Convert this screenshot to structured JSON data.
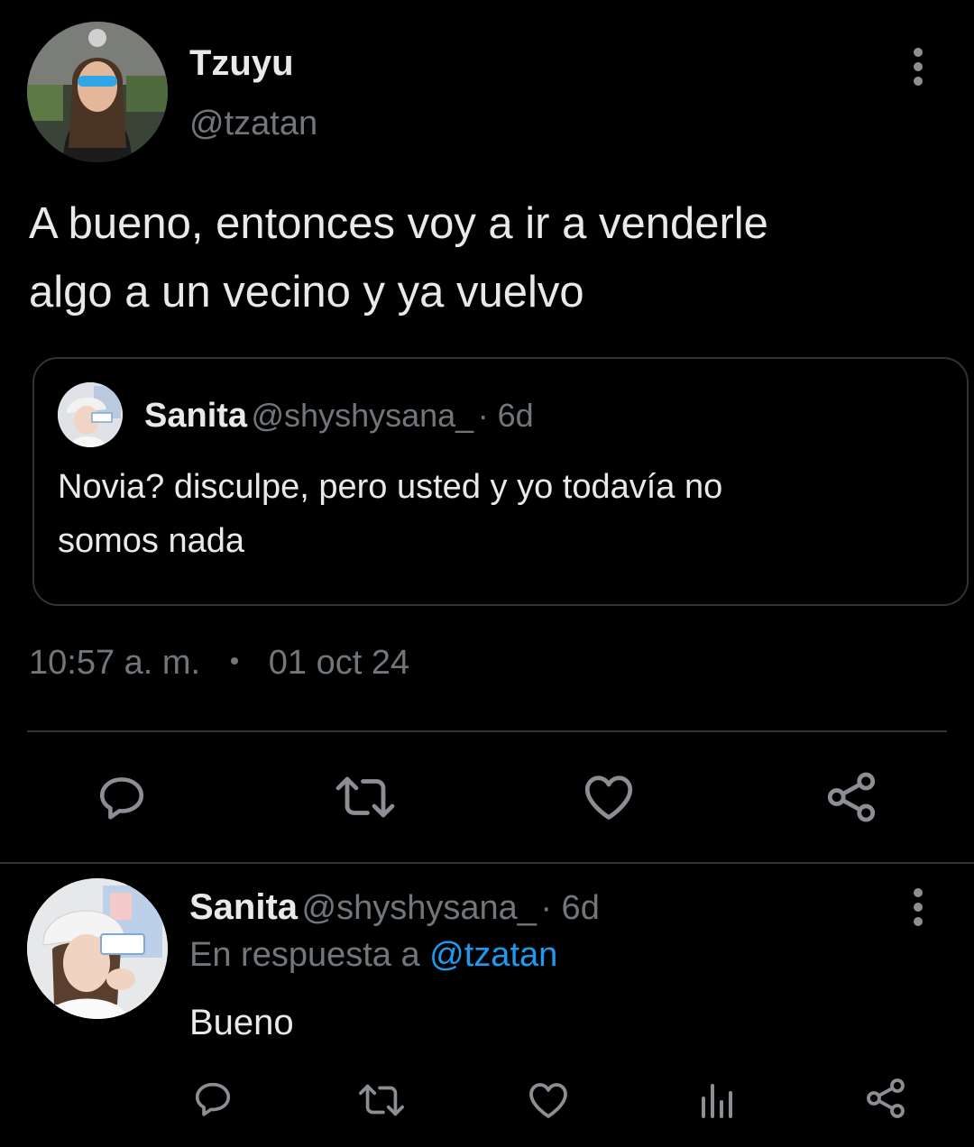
{
  "main_tweet": {
    "author_name": "Tzuyu",
    "author_handle": "@tzatan",
    "text_line1": "A bueno, entonces voy a ir a venderle",
    "text_line2": "algo a un vecino y ya vuelvo",
    "time": "10:57 a. m.",
    "separator": "•",
    "date": "01 oct 24"
  },
  "quoted_tweet": {
    "author_name": "Sanita",
    "author_handle": "@shyshysana_",
    "age": "· 6d",
    "text_line1": "Novia? disculpe, pero usted y yo todavía no",
    "text_line2": "somos nada"
  },
  "reply": {
    "author_name": "Sanita",
    "author_handle": "@shyshysana_",
    "age": "· 6d",
    "reply_prefix": "En respuesta a",
    "reply_to": "@tzatan",
    "text": "Bueno"
  },
  "icons": {
    "more": "more-vertical-icon",
    "reply": "reply-icon",
    "retweet": "retweet-icon",
    "like": "heart-icon",
    "share": "share-icon",
    "views": "views-icon"
  },
  "colors": {
    "background": "#000000",
    "primary_text": "#e7e9ea",
    "secondary_text": "#71767b",
    "link": "#1d9bf0",
    "border": "#2f3336"
  }
}
